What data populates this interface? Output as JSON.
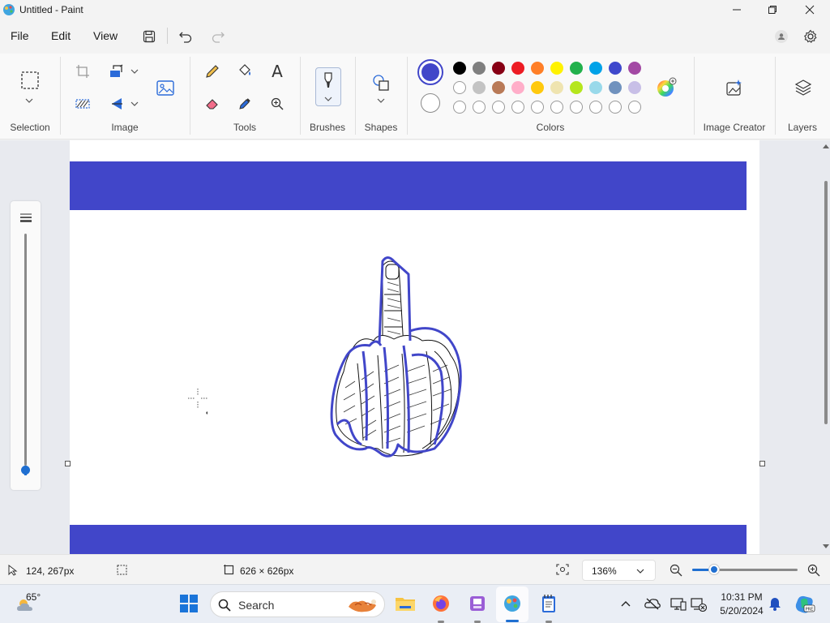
{
  "window": {
    "title": "Untitled - Paint"
  },
  "menu": {
    "file": "File",
    "edit": "Edit",
    "view": "View"
  },
  "ribbon": {
    "groups": {
      "selection": "Selection",
      "image": "Image",
      "tools": "Tools",
      "brushes": "Brushes",
      "shapes": "Shapes",
      "colors": "Colors",
      "image_creator": "Image Creator",
      "layers": "Layers"
    },
    "text_tool_glyph": "A",
    "colors": {
      "primary": "#4146c9",
      "secondary": "#ffffff",
      "row1": [
        "#000000",
        "#7f7f7f",
        "#880015",
        "#ed1c24",
        "#ff7f27",
        "#fff200",
        "#22b14c",
        "#00a2e8",
        "#3f48cc",
        "#a349a4"
      ],
      "row2": [
        "#ffffff",
        "#c3c3c3",
        "#b97a57",
        "#ffaec9",
        "#ffc90e",
        "#efe4b0",
        "#b5e61d",
        "#99d9ea",
        "#7092be",
        "#c8bfe7"
      ]
    }
  },
  "canvas": {
    "band_color": "#4146c9",
    "stroke_color": "#4146c9"
  },
  "status": {
    "cursor_position": "124, 267px",
    "canvas_size": "626 × 626px",
    "zoom": "136%"
  },
  "taskbar": {
    "weather_temp": "65°",
    "search_placeholder": "Search",
    "time": "10:31 PM",
    "date": "5/20/2024"
  }
}
